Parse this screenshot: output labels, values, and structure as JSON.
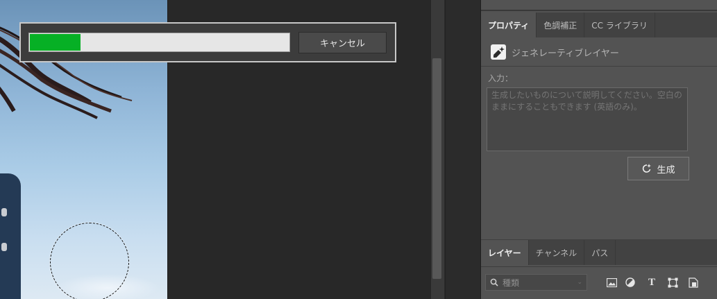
{
  "dialog": {
    "cancel_label": "キャンセル",
    "progress_percent": 20,
    "progress_color": "#06b025"
  },
  "properties_panel": {
    "tabs": [
      {
        "label": "プロパティ",
        "active": true
      },
      {
        "label": "色調補正",
        "active": false
      },
      {
        "label": "CC ライブラリ",
        "active": false
      }
    ],
    "layer_type_icon": "generative-layer-icon",
    "layer_type_label": "ジェネレーティブレイヤー",
    "input_label": "入力：",
    "prompt_placeholder": "生成したいものについて説明してください。空白のままにすることもできます (英語のみ)。",
    "prompt_value": "",
    "generate_button_label": "生成",
    "generate_icon": "generate-sparkle-icon"
  },
  "layers_panel": {
    "tabs": [
      {
        "label": "レイヤー",
        "active": true
      },
      {
        "label": "チャンネル",
        "active": false
      },
      {
        "label": "パス",
        "active": false
      }
    ],
    "filter_kind_placeholder": "種類",
    "filter_icons": [
      "image-filter-icon",
      "adjustment-filter-icon",
      "type-filter-icon",
      "shape-filter-icon",
      "smart-object-filter-icon"
    ]
  }
}
